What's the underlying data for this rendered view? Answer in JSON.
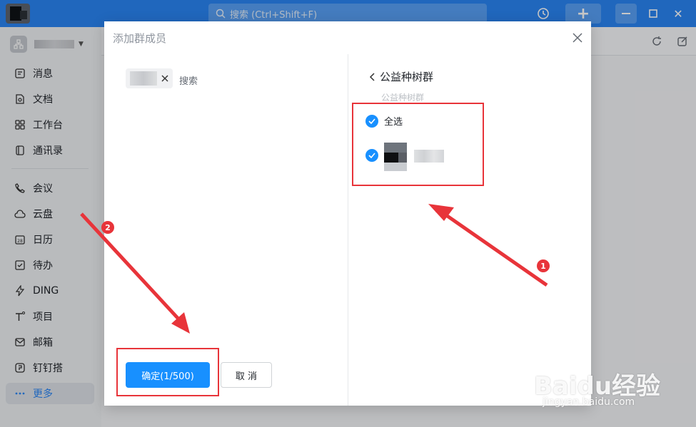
{
  "titlebar": {
    "search_placeholder": "搜索 (Ctrl+Shift+F)",
    "plus_label": "+",
    "close_label": "✕"
  },
  "sidebar": {
    "items": [
      {
        "label": "消息",
        "icon": "chat-icon"
      },
      {
        "label": "文档",
        "icon": "document-icon"
      },
      {
        "label": "工作台",
        "icon": "apps-grid-icon"
      },
      {
        "label": "通讯录",
        "icon": "contacts-icon"
      },
      {
        "label": "会议",
        "icon": "phone-icon"
      },
      {
        "label": "云盘",
        "icon": "cloud-icon"
      },
      {
        "label": "日历",
        "icon": "calendar-icon"
      },
      {
        "label": "待办",
        "icon": "todo-check-icon"
      },
      {
        "label": "DING",
        "icon": "lightning-icon"
      },
      {
        "label": "项目",
        "icon": "project-icon"
      },
      {
        "label": "邮箱",
        "icon": "mail-icon"
      },
      {
        "label": "钉钉搭",
        "icon": "builder-icon"
      },
      {
        "label": "更多",
        "icon": "more-dots-icon",
        "active": true
      }
    ]
  },
  "dialog": {
    "title": "添加群成员",
    "search_hint": "搜索",
    "confirm_label": "确定(1/500)",
    "cancel_label": "取 消",
    "group_title": "公益种树群",
    "breadcrumb": "公益种树群",
    "select_all_label": "全选"
  },
  "annotations": {
    "badge_1": "1",
    "badge_2": "2",
    "color": "#e8343a"
  },
  "watermark": {
    "main": "Baidu经验",
    "sub": "jingyan.baidu.com"
  },
  "colors": {
    "titlebar": "#2a84f3",
    "primary_button": "#1890ff",
    "annotation_red": "#e8343a"
  }
}
